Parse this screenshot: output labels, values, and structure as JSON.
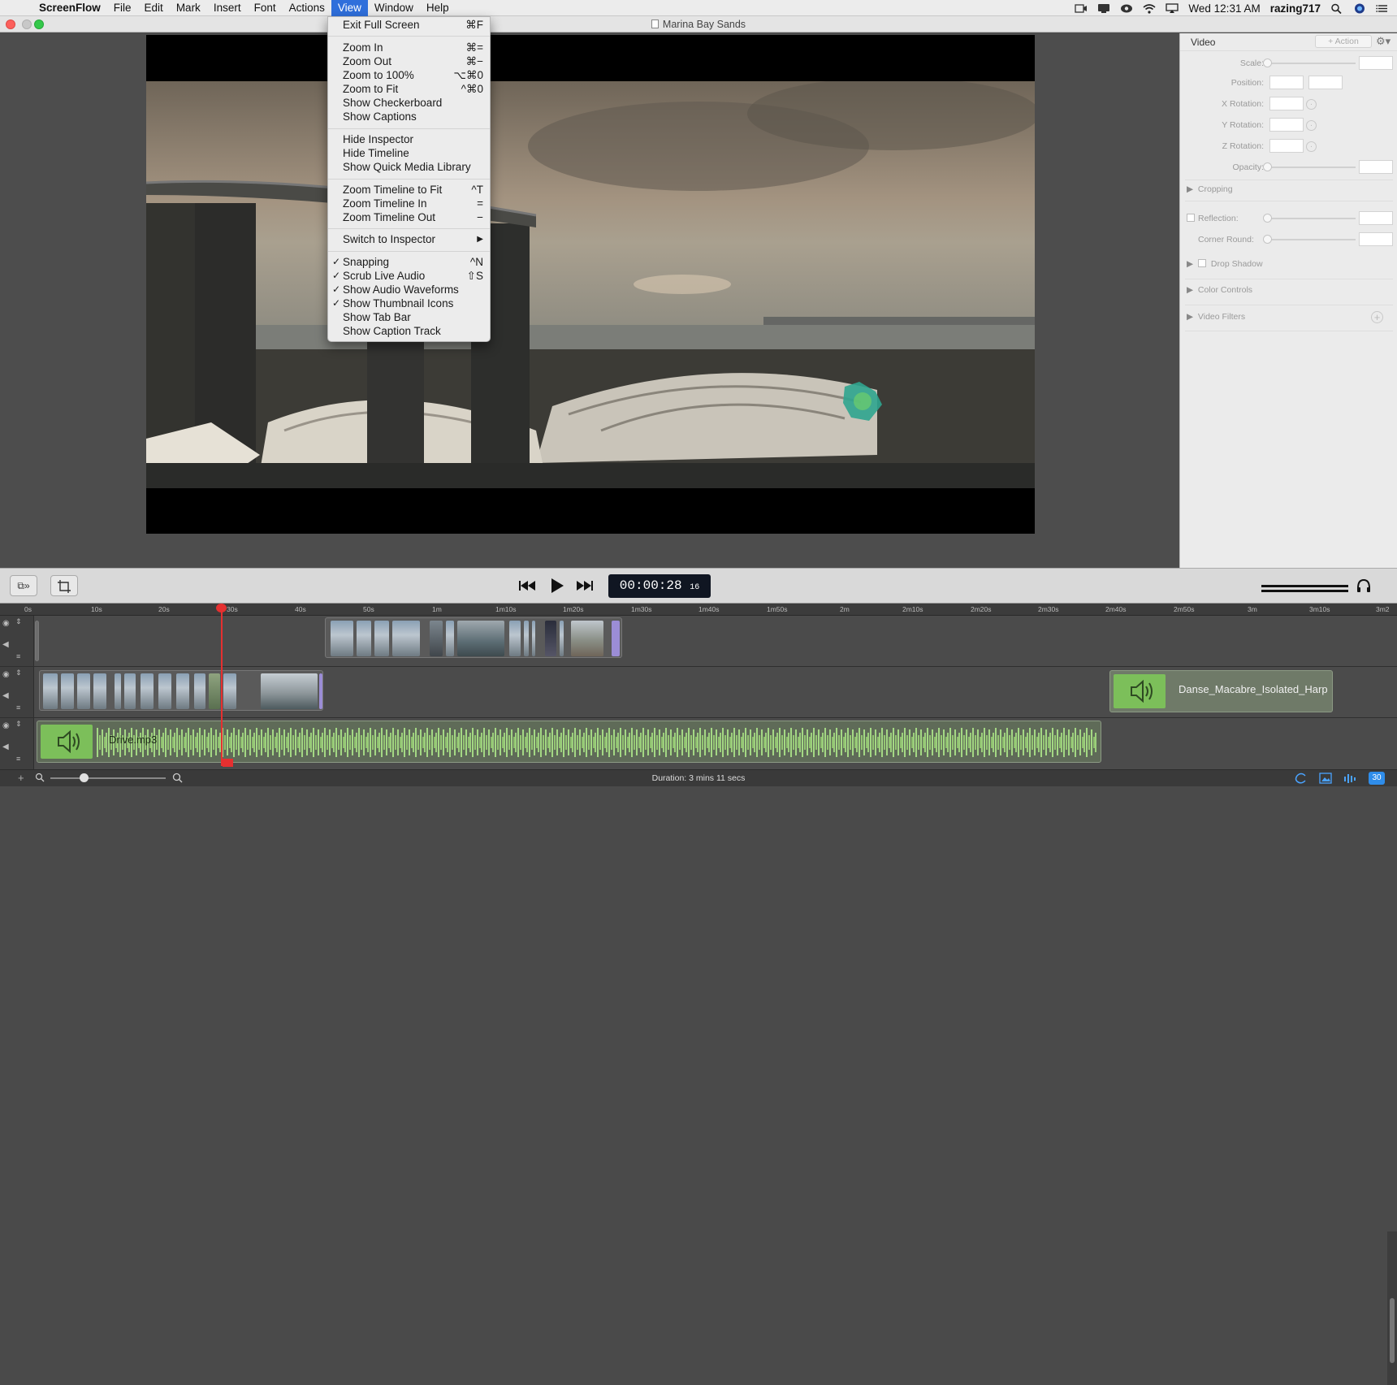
{
  "menubar": {
    "app_name": "ScreenFlow",
    "items": [
      "File",
      "Edit",
      "Mark",
      "Insert",
      "Font",
      "Actions",
      "View",
      "Window",
      "Help"
    ],
    "active_item": "View",
    "clock": "Wed 12:31 AM",
    "user": "razing717"
  },
  "window": {
    "title": "Marina Bay Sands"
  },
  "view_menu": {
    "items": [
      {
        "label": "Exit Full Screen",
        "shortcut": "⌘F",
        "checked": false
      },
      {
        "label": "Zoom In",
        "shortcut": "⌘=",
        "checked": false
      },
      {
        "label": "Zoom Out",
        "shortcut": "⌘−",
        "checked": false
      },
      {
        "label": "Zoom to 100%",
        "shortcut": "⌥⌘0",
        "checked": false
      },
      {
        "label": "Zoom to Fit",
        "shortcut": "^⌘0",
        "checked": false
      },
      {
        "label": "Show Checkerboard",
        "shortcut": "",
        "checked": false
      },
      {
        "label": "Show Captions",
        "shortcut": "",
        "checked": false
      },
      {
        "label": "Hide Inspector",
        "shortcut": "",
        "checked": false
      },
      {
        "label": "Hide Timeline",
        "shortcut": "",
        "checked": false
      },
      {
        "label": "Show Quick Media Library",
        "shortcut": "",
        "checked": false
      },
      {
        "label": "Zoom Timeline to Fit",
        "shortcut": "^T",
        "checked": false
      },
      {
        "label": "Zoom Timeline In",
        "shortcut": "=",
        "checked": false
      },
      {
        "label": "Zoom Timeline Out",
        "shortcut": "−",
        "checked": false
      },
      {
        "label": "Switch to Inspector",
        "shortcut": "▶",
        "checked": false
      },
      {
        "label": "Snapping",
        "shortcut": "^N",
        "checked": true
      },
      {
        "label": "Scrub Live Audio",
        "shortcut": "⇧S",
        "checked": true
      },
      {
        "label": "Show Audio Waveforms",
        "shortcut": "",
        "checked": true
      },
      {
        "label": "Show Thumbnail Icons",
        "shortcut": "",
        "checked": true
      },
      {
        "label": "Show Tab Bar",
        "shortcut": "",
        "checked": false
      },
      {
        "label": "Show Caption Track",
        "shortcut": "",
        "checked": false
      }
    ]
  },
  "inspector": {
    "title": "Video",
    "action_label": "+ Action",
    "scale_label": "Scale:",
    "position_label": "Position:",
    "x_rotation_label": "X Rotation:",
    "y_rotation_label": "Y Rotation:",
    "z_rotation_label": "Z Rotation:",
    "opacity_label": "Opacity:",
    "cropping_label": "Cropping",
    "reflection_label": "Reflection:",
    "corner_round_label": "Corner Round:",
    "drop_shadow_label": "Drop Shadow",
    "color_controls_label": "Color Controls",
    "video_filters_label": "Video Filters"
  },
  "transport": {
    "timecode": "00:00:28",
    "frames": "16"
  },
  "ruler": {
    "labels": [
      "0s",
      "10s",
      "20s",
      "30s",
      "40s",
      "50s",
      "1m",
      "1m10s",
      "1m20s",
      "1m30s",
      "1m40s",
      "1m50s",
      "2m",
      "2m10s",
      "2m20s",
      "2m30s",
      "2m40s",
      "2m50s",
      "3m",
      "3m10s",
      "3m2"
    ]
  },
  "clips": {
    "audio_drive": "Drive.mp3",
    "audio_danse": "Danse_Macabre_Isolated_Harp"
  },
  "status": {
    "duration": "Duration: 3 mins 11 secs",
    "badge": "30"
  },
  "colors": {
    "accent": "#2f6fdb",
    "audio_green": "#7cbf5a",
    "playhead": "#e53030",
    "timecode_bg": "#101622"
  }
}
